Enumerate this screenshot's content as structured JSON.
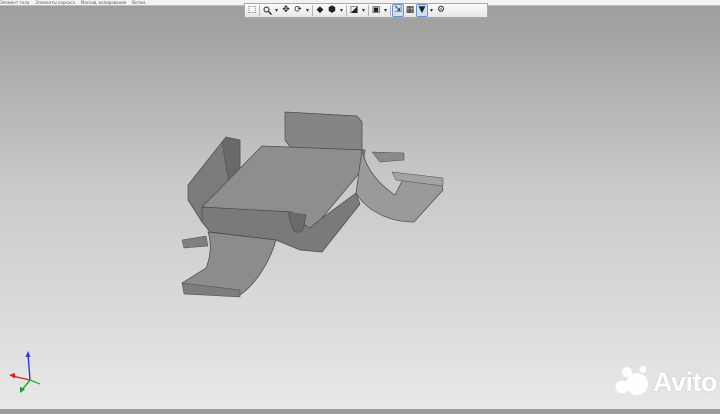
{
  "menu_strip": {
    "items": [
      "Элемент тела",
      "Элементы каркаса",
      "Массив, копирование",
      "Вспом."
    ]
  },
  "toolbar": {
    "buttons": [
      {
        "name": "select-icon",
        "glyph": "⬚"
      },
      {
        "name": "zoom-icon",
        "glyph": "🔍"
      },
      {
        "name": "zoom-dropdown",
        "glyph": "▾"
      },
      {
        "name": "pan-icon",
        "glyph": "✥"
      },
      {
        "name": "rotate-icon",
        "glyph": "⟳"
      },
      {
        "name": "orientation-dropdown",
        "glyph": "▾"
      },
      {
        "name": "shaded-view-icon",
        "glyph": "◆"
      },
      {
        "name": "display-mode-icon",
        "glyph": "⬢"
      },
      {
        "name": "display-mode-dropdown",
        "glyph": "▾"
      },
      {
        "name": "section-view-icon",
        "glyph": "◪"
      },
      {
        "name": "section-dropdown",
        "glyph": "▾"
      },
      {
        "name": "hide-icon",
        "glyph": "▣"
      },
      {
        "name": "hide-dropdown",
        "glyph": "▾"
      },
      {
        "name": "snap-icon",
        "glyph": "⇲"
      },
      {
        "name": "grid-icon",
        "glyph": "▦"
      },
      {
        "name": "filter-icon",
        "glyph": "▼"
      },
      {
        "name": "filter-dropdown",
        "glyph": "▾"
      },
      {
        "name": "settings-icon",
        "glyph": "⚙"
      }
    ]
  },
  "colors": {
    "part_face_top": "#8c8c8c",
    "part_face_side": "#6e6e6e",
    "part_edge": "#4a4a4a",
    "axis_x": "#d62020",
    "axis_y": "#1e9e2a",
    "axis_z": "#2a3fd0",
    "watermark": "#ffffff"
  },
  "watermark": {
    "text": "Avito"
  }
}
